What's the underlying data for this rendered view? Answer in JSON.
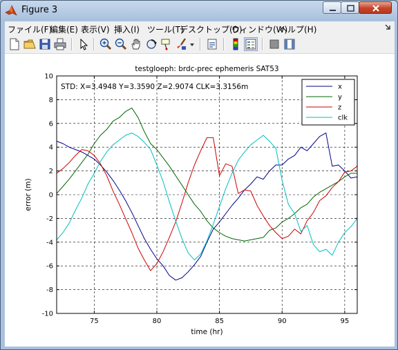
{
  "window": {
    "title": "Figure 3",
    "controls": [
      "minimize-button",
      "maximize-button",
      "close-button"
    ]
  },
  "menu": {
    "items": [
      "ファイル(F)",
      "編集(E)",
      "表示(V)",
      "挿入(I)",
      "ツール(T)",
      "デスクトップ(D)",
      "ウィンドウ(W)",
      "ヘルプ(H)"
    ]
  },
  "toolbar": {
    "buttons": [
      "new-figure-icon",
      "open-file-icon",
      "save-icon",
      "print-icon",
      "edit-plot-arrow-icon",
      "zoom-in-icon",
      "zoom-out-icon",
      "pan-hand-icon",
      "rotate-3d-icon",
      "data-cursor-icon",
      "brush-icon",
      "brush-dropdown-icon",
      "link-plot-icon",
      "insert-colorbar-icon",
      "insert-legend-icon",
      "hide-plot-tools-icon",
      "show-plot-tools-icon"
    ]
  },
  "colors": {
    "x": "#00008b",
    "y": "#006400",
    "z": "#cc0000",
    "clk": "#00bfbf"
  },
  "chart_data": {
    "type": "line",
    "title": "testgloeph: brdc-prec ephemeris SAT53",
    "xlabel": "time (hr)",
    "ylabel": "error (m)",
    "xlim": [
      72,
      96
    ],
    "ylim": [
      -10,
      10
    ],
    "xticks": [
      75,
      80,
      85,
      90,
      95
    ],
    "yticks": [
      -10,
      -8,
      -6,
      -4,
      -2,
      0,
      2,
      4,
      6,
      8,
      10
    ],
    "grid": true,
    "grid_style": "dashed",
    "legend_position": "top-right",
    "annotation": "STD: X=3.4948 Y=3.3590 Z=2.9074 CLK=3.3156m",
    "series": [
      {
        "name": "x",
        "x": [
          72,
          72.5,
          73,
          73.5,
          74,
          74.5,
          75,
          75.5,
          76,
          76.5,
          77,
          77.5,
          78,
          78.5,
          79,
          79.5,
          80,
          80.5,
          81,
          81.5,
          82,
          82.5,
          83,
          83.5,
          84,
          84.5,
          85,
          85.5,
          86,
          86.5,
          87,
          87.5,
          88,
          88.5,
          89,
          89.5,
          90,
          90.5,
          91,
          91.5,
          92,
          92.5,
          93,
          93.5,
          94,
          94.5,
          95,
          95.5,
          96
        ],
        "y": [
          4.5,
          4.3,
          4.0,
          3.8,
          3.6,
          3.3,
          3.0,
          2.5,
          1.9,
          1.2,
          0.4,
          -0.5,
          -1.5,
          -2.6,
          -3.7,
          -4.6,
          -5.4,
          -6.0,
          -6.8,
          -7.2,
          -7.0,
          -6.5,
          -5.9,
          -5.2,
          -4.0,
          -2.9,
          -2.3,
          -1.6,
          -0.9,
          -0.3,
          0.4,
          0.9,
          1.5,
          1.3,
          2.0,
          2.5,
          2.5,
          3.0,
          3.3,
          4.0,
          3.7,
          4.3,
          4.9,
          5.2,
          2.4,
          2.5,
          2.0,
          1.4,
          1.5
        ]
      },
      {
        "name": "y",
        "x": [
          72,
          72.5,
          73,
          73.5,
          74,
          74.5,
          75,
          75.5,
          76,
          76.5,
          77,
          77.5,
          78,
          78.5,
          79,
          79.5,
          80,
          80.5,
          81,
          81.5,
          82,
          82.5,
          83,
          83.5,
          84,
          84.5,
          85,
          85.5,
          86,
          86.5,
          87,
          87.5,
          88,
          88.5,
          89,
          89.5,
          90,
          90.5,
          91,
          91.5,
          92,
          92.5,
          93,
          93.5,
          94,
          94.5,
          95,
          95.5,
          96
        ],
        "y": [
          0.1,
          0.7,
          1.3,
          2.0,
          2.7,
          3.4,
          4.3,
          5.0,
          5.5,
          6.2,
          6.5,
          7.0,
          7.3,
          6.5,
          5.3,
          4.3,
          3.8,
          3.1,
          2.4,
          1.6,
          0.8,
          0.0,
          -0.8,
          -1.4,
          -2.2,
          -2.8,
          -3.2,
          -3.5,
          -3.7,
          -3.8,
          -3.9,
          -3.8,
          -3.7,
          -3.6,
          -3.0,
          -2.8,
          -2.3,
          -2.0,
          -1.6,
          -1.1,
          -0.8,
          -0.2,
          0.2,
          0.5,
          0.8,
          1.1,
          1.5,
          1.8,
          1.8
        ]
      },
      {
        "name": "z",
        "x": [
          72,
          72.5,
          73,
          73.5,
          74,
          74.5,
          75,
          75.5,
          76,
          76.5,
          77,
          77.5,
          78,
          78.5,
          79,
          79.5,
          80,
          80.5,
          81,
          81.5,
          82,
          82.5,
          83,
          83.5,
          84,
          84.5,
          85,
          85.5,
          86,
          86.5,
          87,
          87.5,
          88,
          88.5,
          89,
          89.5,
          90,
          90.5,
          91,
          91.5,
          92,
          92.5,
          93,
          93.5,
          94,
          94.5,
          95,
          95.5,
          96
        ],
        "y": [
          1.8,
          2.2,
          2.7,
          3.3,
          3.8,
          3.7,
          3.3,
          2.6,
          1.6,
          0.3,
          -0.8,
          -2.0,
          -3.2,
          -4.5,
          -5.5,
          -6.4,
          -5.8,
          -4.8,
          -3.6,
          -2.3,
          -0.7,
          1.0,
          2.5,
          3.7,
          4.8,
          4.8,
          1.6,
          2.6,
          2.4,
          0.1,
          0.4,
          0.3,
          -0.9,
          -1.8,
          -2.6,
          -3.2,
          -3.7,
          -3.5,
          -2.9,
          -3.3,
          -2.2,
          -1.5,
          -0.5,
          -0.1,
          0.6,
          1.1,
          1.9,
          2.0,
          2.4
        ]
      },
      {
        "name": "clk",
        "x": [
          72,
          72.5,
          73,
          73.5,
          74,
          74.5,
          75,
          75.5,
          76,
          76.5,
          77,
          77.5,
          78,
          78.5,
          79,
          79.5,
          80,
          80.5,
          81,
          81.5,
          82,
          82.5,
          83,
          83.5,
          84,
          84.5,
          85,
          85.5,
          86,
          86.5,
          87,
          87.5,
          88,
          88.5,
          89,
          89.5,
          90,
          90.5,
          91,
          91.5,
          92,
          92.5,
          93,
          93.5,
          94,
          94.5,
          95,
          95.5,
          96
        ],
        "y": [
          -3.8,
          -3.2,
          -2.4,
          -1.3,
          -0.3,
          0.9,
          1.8,
          2.8,
          3.6,
          4.2,
          4.6,
          5.0,
          5.2,
          4.9,
          4.4,
          3.8,
          2.5,
          1.1,
          -0.6,
          -2.2,
          -3.7,
          -4.9,
          -5.5,
          -5.0,
          -3.9,
          -2.5,
          -1.0,
          0.5,
          1.8,
          2.9,
          3.6,
          4.2,
          4.6,
          5.0,
          4.5,
          3.9,
          1.2,
          -0.8,
          -1.6,
          -3.1,
          -2.6,
          -4.2,
          -4.8,
          -4.6,
          -5.1,
          -4.0,
          -3.2,
          -2.7,
          -2.0
        ]
      }
    ]
  }
}
